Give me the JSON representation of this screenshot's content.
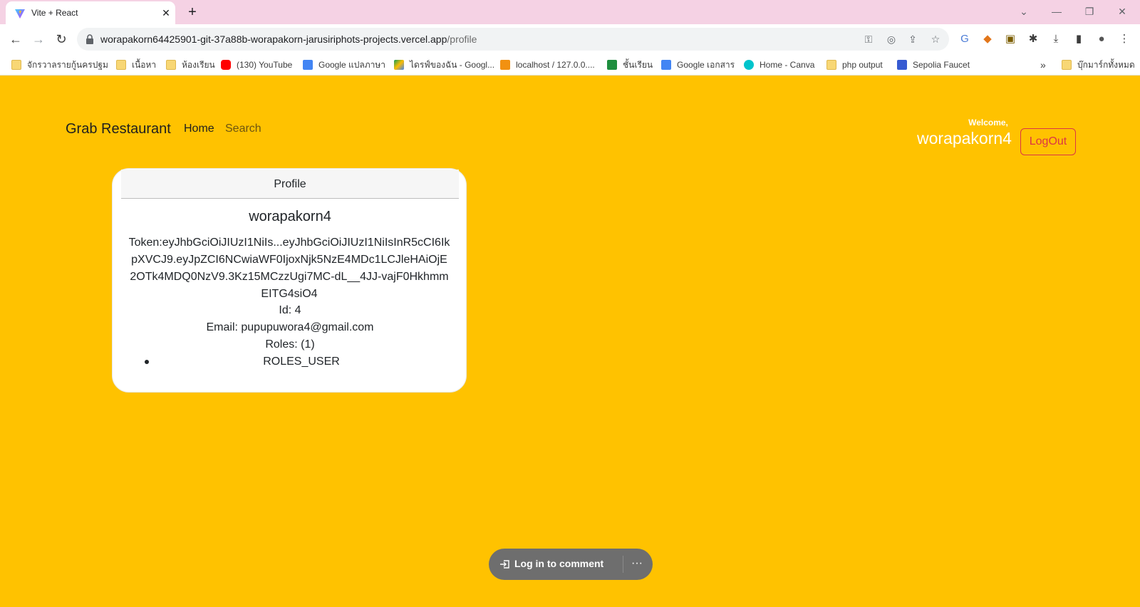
{
  "browser": {
    "tab_title": "Vite + React",
    "url_host": "worapakorn64425901-git-37a88b-worapakorn-jarusiriphots-projects.vercel.app",
    "url_path": "/profile",
    "new_tab": "+",
    "bookmarks": [
      {
        "label": "จักรวาลรายกู้นครปฐม",
        "icon": "folder-icon"
      },
      {
        "label": "เนื้อหา",
        "icon": "folder-icon"
      },
      {
        "label": "ห้องเรียน",
        "icon": "folder-icon"
      },
      {
        "label": "(130) YouTube",
        "icon": "youtube-icon"
      },
      {
        "label": "Google แปลภาษา",
        "icon": "google-translate-icon"
      },
      {
        "label": "ไดรฟ์ของฉัน - Googl...",
        "icon": "google-drive-icon"
      },
      {
        "label": "localhost / 127.0.0....",
        "icon": "phpmyadmin-icon"
      },
      {
        "label": "ชั้นเรียน",
        "icon": "google-classroom-icon"
      },
      {
        "label": "Google เอกสาร",
        "icon": "google-docs-icon"
      },
      {
        "label": "Home - Canva",
        "icon": "canva-icon"
      },
      {
        "label": "php output",
        "icon": "folder-icon"
      },
      {
        "label": "Sepolia Faucet",
        "icon": "alchemy-icon"
      }
    ],
    "bookmarks_overflow": "»",
    "all_bookmarks": "บุ๊กมาร์กทั้งหมด"
  },
  "navbar": {
    "brand": "Grab Restaurant",
    "links": [
      "Home",
      "Search"
    ],
    "welcome_label": "Welcome,",
    "username": "worapakorn4",
    "logout_label": "LogOut"
  },
  "profile": {
    "header": "Profile",
    "username": "worapakorn4",
    "token": "Token:eyJhbGciOiJIUzI1NiIs...eyJhbGciOiJIUzI1NiIsInR5cCI6IkpXVCJ9.eyJpZCI6NCwiaWF0IjoxNjk5NzE4MDc1LCJleHAiOjE2OTk4MDQ0NzV9.3Kz15MCzzUgi7MC-dL__4JJ-vajF0HkhmmEITG4siO4",
    "id_line": "Id: 4",
    "email_line": "Email: pupupuwora4@gmail.com",
    "roles_line": "Roles: (1)",
    "roles": [
      "ROLES_USER"
    ]
  },
  "comment_bar": {
    "label": "Log in to comment",
    "more": "···"
  },
  "colors": {
    "page_bg": "#ffc200",
    "danger": "#dc3545",
    "titlebar": "#f5d2e4"
  }
}
